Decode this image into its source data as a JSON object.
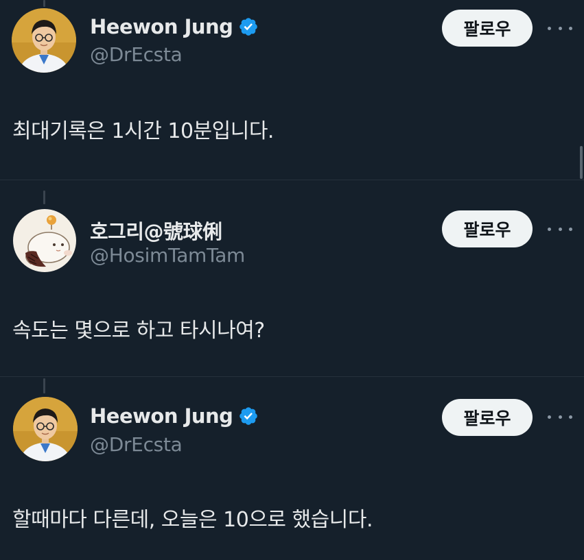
{
  "tweets": [
    {
      "display_name": "Heewon Jung",
      "verified": true,
      "handle": "@DrEcsta",
      "follow_label": "팔로우",
      "text": "최대기록은 1시간 10분입니다.",
      "avatar": "person-portrait"
    },
    {
      "display_name": "호그리@號球俐",
      "verified": false,
      "handle": "@HosimTamTam",
      "follow_label": "팔로우",
      "text": "속도는 몇으로 하고 타시나여?",
      "avatar": "character-illustration"
    },
    {
      "display_name": "Heewon Jung",
      "verified": true,
      "handle": "@DrEcsta",
      "follow_label": "팔로우",
      "text": "할때마다 다른데, 오늘은 10으로 했습니다.",
      "avatar": "person-portrait"
    }
  ],
  "colors": {
    "background": "#15202b",
    "text": "#e7e9ea",
    "muted": "#7d8a96",
    "verified": "#1d9bf0",
    "follow_bg": "#eff3f4"
  }
}
